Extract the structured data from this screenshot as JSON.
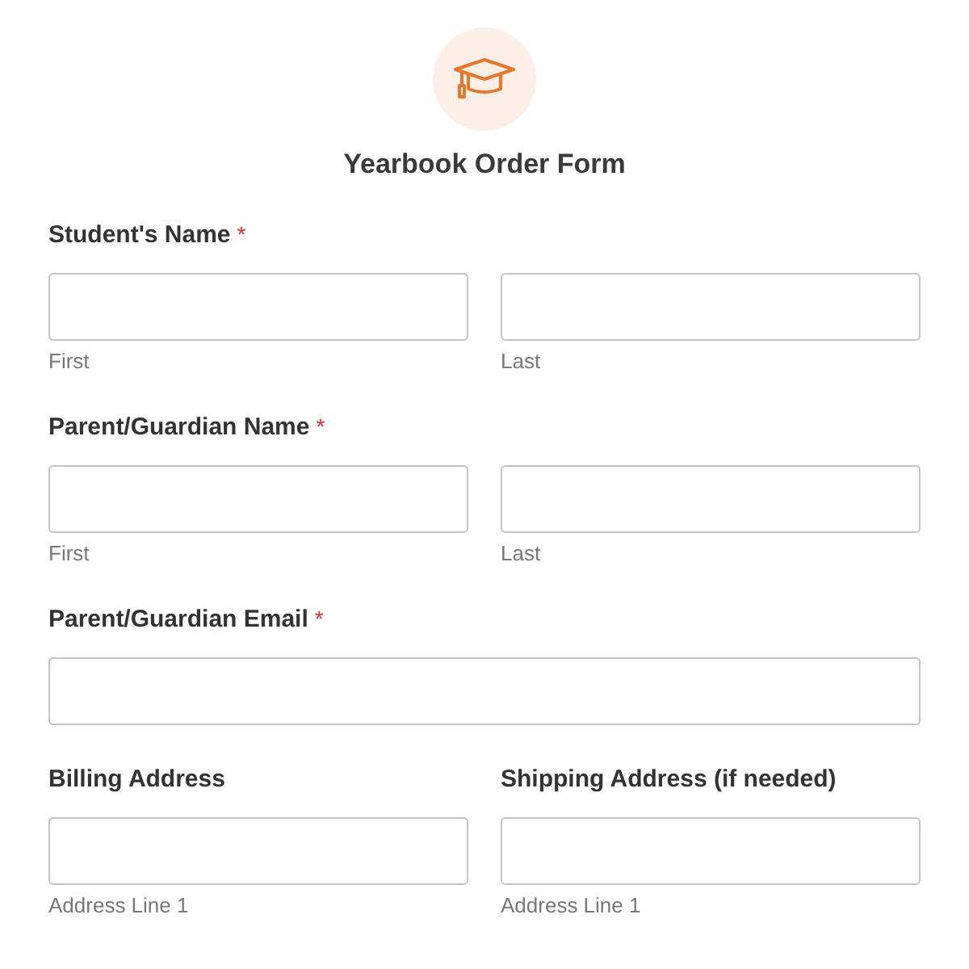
{
  "form": {
    "title": "Yearbook Order Form",
    "required_marker": "*"
  },
  "rows": [
    {
      "columns": [
        {
          "label": "Student's Name",
          "required": true,
          "fields": [
            {
              "kind": "text",
              "sublabel": "First"
            },
            {
              "kind": "text",
              "sublabel": "Last"
            }
          ]
        }
      ]
    },
    {
      "columns": [
        {
          "label": "Parent/Guardian Name",
          "required": true,
          "fields": [
            {
              "kind": "text",
              "sublabel": "First"
            },
            {
              "kind": "text",
              "sublabel": "Last"
            }
          ]
        }
      ]
    },
    {
      "columns": [
        {
          "label": "Parent/Guardian Email",
          "required": true,
          "fields": [
            {
              "kind": "text"
            }
          ]
        }
      ]
    },
    {
      "columns": [
        {
          "label": "Billing Address",
          "required": false,
          "fields": [
            {
              "kind": "text",
              "sublabel": "Address Line 1"
            }
          ]
        },
        {
          "label": "Shipping Address (if needed)",
          "required": false,
          "fields": [
            {
              "kind": "text",
              "sublabel": "Address Line 1"
            }
          ]
        }
      ]
    }
  ]
}
